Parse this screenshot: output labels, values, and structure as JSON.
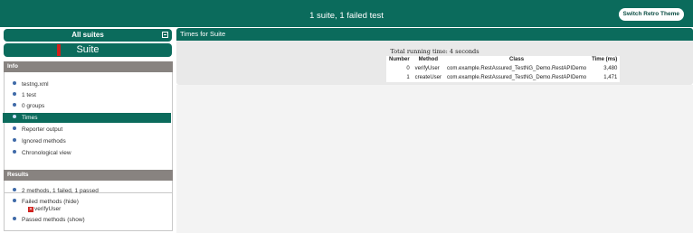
{
  "header": {
    "title": "1 suite, 1 failed test",
    "retro_button": "Switch Retro Theme"
  },
  "sidebar": {
    "all_suites": "All suites",
    "suite_name": "Suite",
    "info_title": "Info",
    "info_items": [
      {
        "label": "testng.xml"
      },
      {
        "label": "1 test"
      },
      {
        "label": "0 groups"
      },
      {
        "label": "Times"
      },
      {
        "label": "Reporter output"
      },
      {
        "label": "Ignored methods"
      },
      {
        "label": "Chronological view"
      }
    ],
    "results_title": "Results",
    "results_items": [
      {
        "label": "2 methods, 1 failed, 1 passed"
      },
      {
        "label": "Failed methods (hide)"
      },
      {
        "label": "Passed methods (show)"
      }
    ],
    "failed_method": "verifyUser"
  },
  "main": {
    "panel_title": "Times for Suite",
    "running_time": "Total running time: 4 seconds",
    "columns": [
      "Number",
      "Method",
      "Class",
      "Time (ms)"
    ],
    "rows": [
      {
        "number": "0",
        "method": "verifyUser",
        "class": "com.example.RestAssured_TestNG_Demo.RestAPIDemo",
        "time": "3,480"
      },
      {
        "number": "1",
        "method": "createUser",
        "class": "com.example.RestAssured_TestNG_Demo.RestAPIDemo",
        "time": "1,471"
      }
    ]
  },
  "colors": {
    "accent": "#0b6b5c",
    "section_header": "#888380",
    "failed": "#d0201c"
  }
}
